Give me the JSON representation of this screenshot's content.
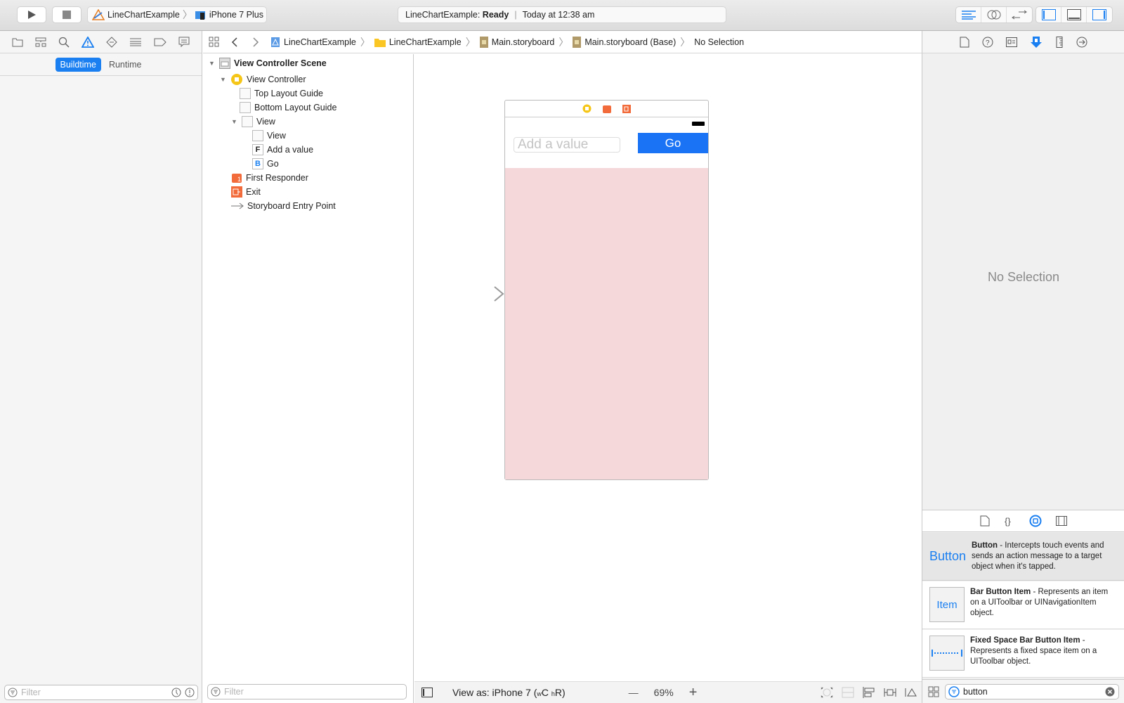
{
  "toolbar": {
    "run_icon": "play-icon",
    "stop_icon": "stop-icon",
    "scheme": {
      "project": "LineChartExample",
      "device": "iPhone 7 Plus"
    },
    "activity": {
      "project": "LineChartExample:",
      "status": "Ready",
      "time": "Today at 12:38 am"
    },
    "editor_modes": [
      "standard-editor-icon",
      "assistant-editor-icon",
      "version-editor-icon"
    ],
    "panel_toggles": [
      "navigator-toggle-icon",
      "debug-area-toggle-icon",
      "utilities-toggle-icon"
    ]
  },
  "navigator": {
    "icons": [
      "folder-icon",
      "hierarchy-icon",
      "search-icon",
      "warning-icon",
      "test-icon",
      "debug-icon",
      "breakpoint-icon",
      "report-icon"
    ],
    "segments": [
      {
        "label": "Buildtime",
        "active": true
      },
      {
        "label": "Runtime",
        "active": false
      }
    ],
    "filter_placeholder": "Filter"
  },
  "jumpbar": {
    "crumbs": [
      "LineChartExample",
      "LineChartExample",
      "Main.storyboard",
      "Main.storyboard (Base)",
      "No Selection"
    ]
  },
  "outline": {
    "items": [
      {
        "label": "View Controller Scene",
        "level": 0,
        "bold": true
      },
      {
        "label": "View Controller",
        "level": 1
      },
      {
        "label": "Top Layout Guide",
        "level": 2
      },
      {
        "label": "Bottom Layout Guide",
        "level": 2
      },
      {
        "label": "View",
        "level": 2
      },
      {
        "label": "View",
        "level": 3
      },
      {
        "label": "Add a value",
        "level": 3,
        "badge": "F"
      },
      {
        "label": "Go",
        "level": 3,
        "badge": "B"
      },
      {
        "label": "First Responder",
        "level": 1
      },
      {
        "label": "Exit",
        "level": 1
      },
      {
        "label": "Storyboard Entry Point",
        "level": 1
      }
    ],
    "filter_placeholder": "Filter"
  },
  "canvas": {
    "textfield_placeholder": "Add a value",
    "go_button": "Go",
    "view_bg": "#f5d8da",
    "accent": "#1a73f5"
  },
  "bottombar": {
    "view_as": "View as: iPhone 7 (",
    "w": "w",
    "wc": "C ",
    "h": "h",
    "hr": "R)",
    "zoom": "69%",
    "minus": "—",
    "plus": "+"
  },
  "inspector": {
    "icons": [
      "file-inspector-icon",
      "quick-help-icon",
      "identity-icon",
      "attributes-icon",
      "size-icon",
      "connections-icon"
    ],
    "empty": "No Selection",
    "library_tabs": [
      "file-template-icon",
      "code-snippet-icon",
      "object-library-icon",
      "media-library-icon"
    ],
    "library": [
      {
        "thumb": "Button",
        "title": "Button",
        "desc": " - Intercepts touch events and sends an action message to a target object when it's tapped."
      },
      {
        "thumb": "Item",
        "title": "Bar Button Item",
        "desc": " - Represents an item on a UIToolbar or UINavigationItem object."
      },
      {
        "thumb": "",
        "title": "Fixed Space Bar Button Item",
        "desc": " - Represents a fixed space item on a UIToolbar object."
      }
    ],
    "search_value": "button"
  }
}
